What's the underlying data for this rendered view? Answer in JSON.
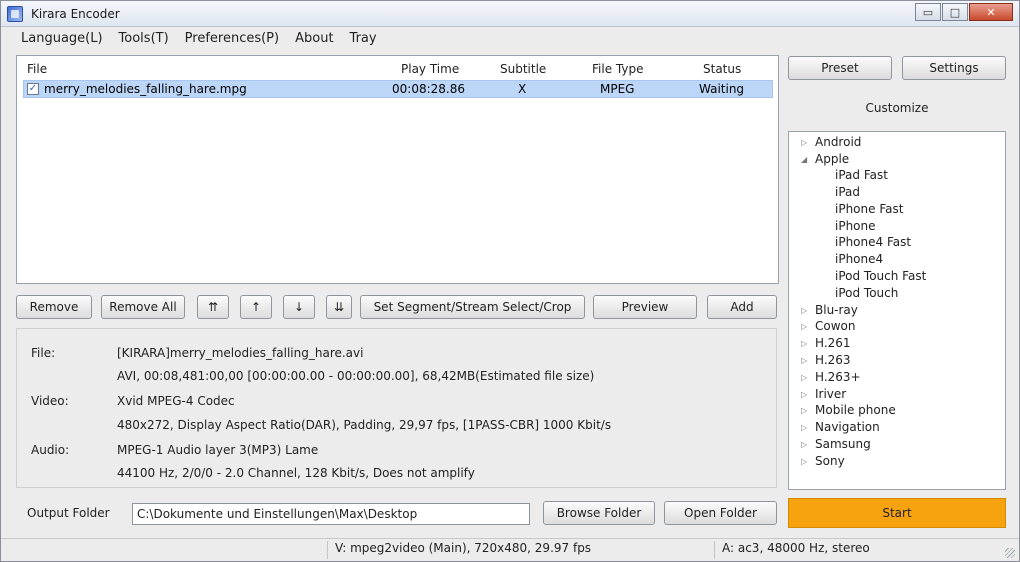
{
  "window": {
    "title": "Kirara Encoder",
    "minimize": "▭",
    "maximize": "□",
    "close": "✕"
  },
  "menu": [
    "Language(L)",
    "Tools(T)",
    "Preferences(P)",
    "About",
    "Tray"
  ],
  "filelist": {
    "headers": {
      "file": "File",
      "play_time": "Play Time",
      "subtitle": "Subtitle",
      "file_type": "File Type",
      "status": "Status"
    },
    "rows": [
      {
        "checked": "✓",
        "file": "merry_melodies_falling_hare.mpg",
        "play_time": "00:08:28.86",
        "subtitle": "X",
        "file_type": "MPEG",
        "status": "Waiting"
      }
    ]
  },
  "actions": {
    "remove": "Remove",
    "remove_all": "Remove All",
    "move_top": "⇈",
    "move_up": "↑",
    "move_down": "↓",
    "move_bottom": "⇊",
    "segment": "Set Segment/Stream Select/Crop",
    "preview": "Preview",
    "add": "Add"
  },
  "info": {
    "file_label": "File:",
    "file_name": "[KIRARA]merry_melodies_falling_hare.avi",
    "file_details": "AVI, 00:08,481:00,00 [00:00:00.00 - 00:00:00.00], 68,42MB(Estimated file size)",
    "video_label": "Video:",
    "video_codec": "Xvid MPEG-4 Codec",
    "video_details": "480x272, Display Aspect Ratio(DAR), Padding, 29,97 fps, [1PASS-CBR] 1000 Kbit/s",
    "audio_label": "Audio:",
    "audio_codec": "MPEG-1 Audio layer 3(MP3) Lame",
    "audio_details": "44100 Hz, 2/0/0 - 2.0 Channel, 128 Kbit/s, Does not amplify"
  },
  "output": {
    "label": "Output Folder",
    "path": "C:\\Dokumente und Einstellungen\\Max\\Desktop",
    "browse": "Browse Folder",
    "open": "Open Folder"
  },
  "right": {
    "preset": "Preset",
    "settings": "Settings",
    "customize": "Customize",
    "start": "Start"
  },
  "tree": {
    "android": "Android",
    "apple": "Apple",
    "apple_children": [
      "iPad Fast",
      "iPad",
      "iPhone Fast",
      "iPhone",
      "iPhone4 Fast",
      "iPhone4",
      "iPod Touch Fast",
      "iPod Touch"
    ],
    "others": [
      "Blu-ray",
      "Cowon",
      "H.261",
      "H.263",
      "H.263+",
      "Iriver",
      "Mobile phone",
      "Navigation",
      "Samsung",
      "Sony"
    ]
  },
  "status": {
    "video": "V: mpeg2video (Main), 720x480, 29.97 fps",
    "audio": "A: ac3, 48000 Hz, stereo"
  }
}
